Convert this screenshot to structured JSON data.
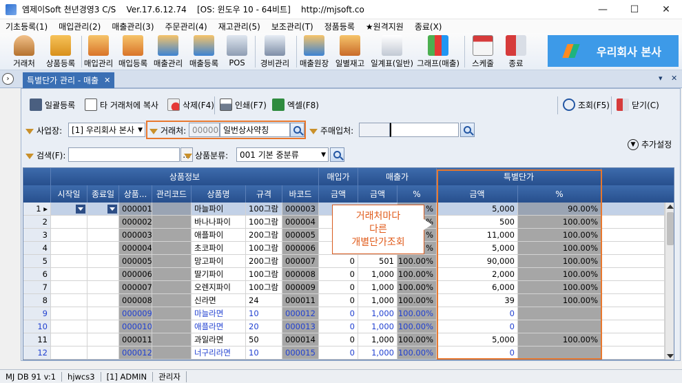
{
  "window": {
    "title": "엠제이Soft 천년경영3 C/S    Ver.17.6.12.74    [OS: 윈도우 10 - 64비트]    http://mjsoft.co",
    "min": "—",
    "max": "☐",
    "close": "✕"
  },
  "menu": [
    "기초등록(1)",
    "매입관리(2)",
    "매출관리(3)",
    "주문관리(4)",
    "재고관리(5)",
    "보조관리(T)",
    "정품등록",
    "★원격지원",
    "종료(X)"
  ],
  "toolbar": {
    "buttons": [
      {
        "label": "거래처",
        "icon": "person-icon"
      },
      {
        "label": "상품등록",
        "icon": "boxes-icon"
      },
      {
        "label": "매입관리",
        "icon": "purchase-icon"
      },
      {
        "label": "매입등록",
        "icon": "purchase-add-icon"
      },
      {
        "label": "매출관리",
        "icon": "sales-icon"
      },
      {
        "label": "매출등록",
        "icon": "sales-add-icon"
      },
      {
        "label": "POS",
        "icon": "pos-icon"
      },
      {
        "label": "경비관리",
        "icon": "expense-icon"
      },
      {
        "label": "매출원장",
        "icon": "ledger-icon"
      },
      {
        "label": "일별재고",
        "icon": "daily-stock-icon"
      },
      {
        "label": "일계표(일반)",
        "icon": "daily-report-icon"
      },
      {
        "label": "그래프(매출)",
        "icon": "graph-icon"
      },
      {
        "label": "스케줄",
        "icon": "calendar-icon"
      },
      {
        "label": "종료",
        "icon": "exit-icon"
      }
    ],
    "brand": "우리회사 본사"
  },
  "doc_tab": {
    "label": "특별단가 관리 - 매출",
    "close": "✕",
    "nav": "›",
    "pin": "▾",
    "close_right": "✕"
  },
  "actions": {
    "bulk_register": "일괄등록",
    "copy_to_other": "타 거래처에 복사",
    "delete": "삭제(F4)",
    "print": "인쇄(F7)",
    "excel": "엑셀(F8)",
    "query": "조회(F5)",
    "close": "닫기(C)"
  },
  "filters": {
    "site_label": "사업장:",
    "site_value": "[1] 우리회사 본사",
    "client_label": "거래처:",
    "client_code": "000001",
    "client_name": "일번상사약칭",
    "main_buyer_label": "주매입처:",
    "main_buyer_value": "",
    "search_label": "검색(F):",
    "search_value": "",
    "category_label": "상품분류:",
    "category_value": "001 기본 중분류",
    "extra_settings": "추가설정",
    "ellipsis": "..."
  },
  "grid": {
    "group_headers": {
      "product_info": "상품정보",
      "purchase_price": "매입가",
      "sale_price": "매출가",
      "special_price": "특별단가"
    },
    "columns": [
      "시작일",
      "종료일",
      "상품...",
      "관리코드",
      "상품명",
      "규격",
      "바코드",
      "금액",
      "금액",
      "%",
      "금액",
      "%"
    ],
    "rows": [
      {
        "no": "1",
        "code": "000001",
        "name": "마늘파이",
        "spec": "100그람",
        "barcode": "000003",
        "buy": "",
        "sale": "",
        "pct": "%",
        "sp_amt": "5,000",
        "sp_pct": "90.00%",
        "blue": false,
        "selected": true
      },
      {
        "no": "2",
        "code": "000002",
        "name": "바나나파이",
        "spec": "100그람",
        "barcode": "000004",
        "buy": "",
        "sale": "",
        "pct": "%",
        "sp_amt": "500",
        "sp_pct": "100.00%",
        "blue": false,
        "selected": false
      },
      {
        "no": "3",
        "code": "000003",
        "name": "애플파이",
        "spec": "200그람",
        "barcode": "000005",
        "buy": "",
        "sale": "",
        "pct": "%",
        "sp_amt": "11,000",
        "sp_pct": "100.00%",
        "blue": false,
        "selected": false
      },
      {
        "no": "4",
        "code": "000004",
        "name": "초코파이",
        "spec": "100그람",
        "barcode": "000006",
        "buy": "",
        "sale": "",
        "pct": "%",
        "sp_amt": "5,000",
        "sp_pct": "100.00%",
        "blue": false,
        "selected": false
      },
      {
        "no": "5",
        "code": "000005",
        "name": "망고파이",
        "spec": "200그람",
        "barcode": "000007",
        "buy": "0",
        "sale": "501",
        "pct": "100.00%",
        "sp_amt": "90,000",
        "sp_pct": "100.00%",
        "blue": false,
        "selected": false
      },
      {
        "no": "6",
        "code": "000006",
        "name": "딸기파이",
        "spec": "100그람",
        "barcode": "000008",
        "buy": "0",
        "sale": "1,000",
        "pct": "100.00%",
        "sp_amt": "2,000",
        "sp_pct": "100.00%",
        "blue": false,
        "selected": false
      },
      {
        "no": "7",
        "code": "000007",
        "name": "오렌지파이",
        "spec": "100그람",
        "barcode": "000009",
        "buy": "0",
        "sale": "1,000",
        "pct": "100.00%",
        "sp_amt": "6,000",
        "sp_pct": "100.00%",
        "blue": false,
        "selected": false
      },
      {
        "no": "8",
        "code": "000008",
        "name": "신라면",
        "spec": "24",
        "barcode": "000011",
        "buy": "0",
        "sale": "1,000",
        "pct": "100.00%",
        "sp_amt": "39",
        "sp_pct": "100.00%",
        "blue": false,
        "selected": false
      },
      {
        "no": "9",
        "code": "000009",
        "name": "마늘라면",
        "spec": "10",
        "barcode": "000012",
        "buy": "0",
        "sale": "1,000",
        "pct": "100.00%",
        "sp_amt": "0",
        "sp_pct": "",
        "blue": true,
        "selected": false
      },
      {
        "no": "10",
        "code": "000010",
        "name": "애플라면",
        "spec": "20",
        "barcode": "000013",
        "buy": "0",
        "sale": "1,000",
        "pct": "100.00%",
        "sp_amt": "0",
        "sp_pct": "",
        "blue": true,
        "selected": false
      },
      {
        "no": "11",
        "code": "000011",
        "name": "과일라면",
        "spec": "50",
        "barcode": "000014",
        "buy": "0",
        "sale": "1,000",
        "pct": "100.00%",
        "sp_amt": "5,000",
        "sp_pct": "100.00%",
        "blue": false,
        "selected": false
      },
      {
        "no": "12",
        "code": "000012",
        "name": "너구리라면",
        "spec": "10",
        "barcode": "000015",
        "buy": "0",
        "sale": "1,000",
        "pct": "100.00%",
        "sp_amt": "0",
        "sp_pct": "",
        "blue": true,
        "selected": false
      }
    ]
  },
  "callout": {
    "line1": "거래처마다",
    "line2": "다른",
    "line3": "개별단가조회"
  },
  "status": [
    "MJ DB 91 v:1",
    "hjwcs3",
    "[1] ADMIN",
    "관리자"
  ],
  "colors": {
    "header": "#2d5797",
    "highlight": "#e8772d",
    "brand": "#3d9ae8",
    "blue_text": "#1f3fd0"
  }
}
